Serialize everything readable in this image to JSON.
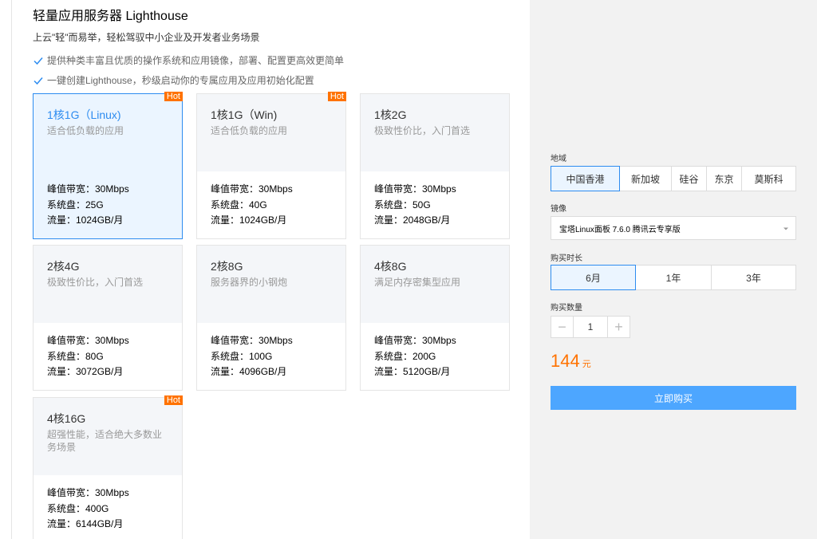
{
  "header": {
    "title": "轻量应用服务器 Lighthouse",
    "subtitle": "上云\"轻\"而易举，轻松驾驭中小企业及开发者业务场景",
    "features": [
      "提供种类丰富且优质的操作系统和应用镜像，部署、配置更高效更简单",
      "一键创建Lighthouse，秒级启动你的专属应用及应用初始化配置"
    ]
  },
  "badge": "Hot",
  "plans": [
    {
      "name": "1核1G（Linux)",
      "desc": "适合低负载的应用",
      "bandwidth": "峰值带宽：30Mbps",
      "disk": "系统盘：25G",
      "traffic": "流量：1024GB/月"
    },
    {
      "name": "1核1G（Win)",
      "desc": "适合低负载的应用",
      "bandwidth": "峰值带宽：30Mbps",
      "disk": "系统盘：40G",
      "traffic": "流量：1024GB/月"
    },
    {
      "name": "1核2G",
      "desc": "极致性价比，入门首选",
      "bandwidth": "峰值带宽：30Mbps",
      "disk": "系统盘：50G",
      "traffic": "流量：2048GB/月"
    },
    {
      "name": "2核4G",
      "desc": "极致性价比，入门首选",
      "bandwidth": "峰值带宽：30Mbps",
      "disk": "系统盘：80G",
      "traffic": "流量：3072GB/月"
    },
    {
      "name": "2核8G",
      "desc": "服务器界的小钢炮",
      "bandwidth": "峰值带宽：30Mbps",
      "disk": "系统盘：100G",
      "traffic": "流量：4096GB/月"
    },
    {
      "name": "4核8G",
      "desc": "满足内存密集型应用",
      "bandwidth": "峰值带宽：30Mbps",
      "disk": "系统盘：200G",
      "traffic": "流量：5120GB/月"
    },
    {
      "name": "4核16G",
      "desc": "超强性能，适合绝大多数业务场景",
      "bandwidth": "峰值带宽：30Mbps",
      "disk": "系统盘：400G",
      "traffic": "流量：6144GB/月"
    }
  ],
  "panel": {
    "region_label": "地域",
    "regions": [
      "中国香港",
      "新加坡",
      "硅谷",
      "东京",
      "莫斯科"
    ],
    "image_label": "镜像",
    "image_value": "宝塔Linux面板 7.6.0 腾讯云专享版",
    "duration_label": "购买时长",
    "durations": [
      "6月",
      "1年",
      "3年"
    ],
    "quantity_label": "购买数量",
    "quantity_minus": "−",
    "quantity": "1",
    "quantity_plus": "+",
    "price": "144",
    "price_unit": "元",
    "buy_label": "立即购买"
  },
  "colors": {
    "accent": "#2d8cf0",
    "price": "#ff7200",
    "hot": "#ff7200",
    "buy_button": "#4da6ff"
  }
}
